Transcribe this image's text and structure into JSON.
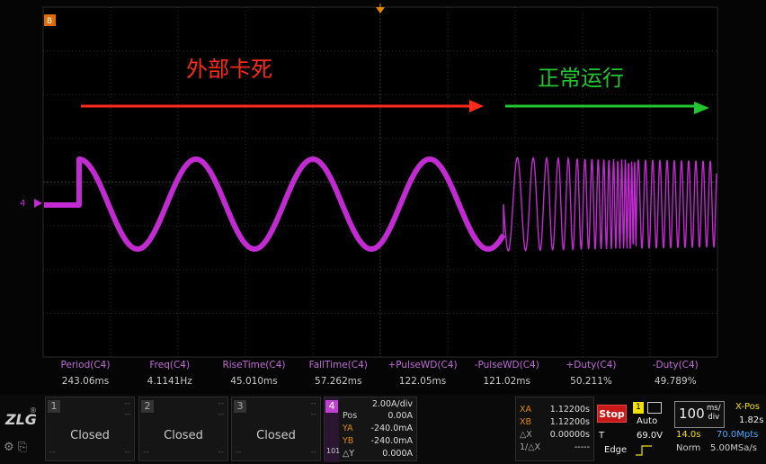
{
  "annotations": {
    "stuck_label": "外部卡死",
    "running_label": "正常运行",
    "stuck_color": "#ff2a1a",
    "running_color": "#22c532"
  },
  "channel_marker": {
    "label": "4",
    "color": "#c22bd1"
  },
  "top_badge": "B",
  "measurements": [
    {
      "name": "Period(C4)",
      "value": "243.06ms"
    },
    {
      "name": "Freq(C4)",
      "value": "4.1141Hz"
    },
    {
      "name": "RiseTime(C4)",
      "value": "45.010ms"
    },
    {
      "name": "FallTime(C4)",
      "value": "57.262ms"
    },
    {
      "name": "+PulseWD(C4)",
      "value": "122.05ms"
    },
    {
      "name": "-PulseWD(C4)",
      "value": "121.02ms"
    },
    {
      "name": "+Duty(C4)",
      "value": "50.211%"
    },
    {
      "name": "-Duty(C4)",
      "value": "49.789%"
    }
  ],
  "logo": {
    "text": "ZLG",
    "reg": "®"
  },
  "channels": [
    {
      "num": "1",
      "state": "Closed"
    },
    {
      "num": "2",
      "state": "Closed"
    },
    {
      "num": "3",
      "state": "Closed"
    }
  ],
  "channel4": {
    "num": "4",
    "scale": "2.00A/div",
    "pos_label": "Pos",
    "pos_value": "0.00A",
    "ya_label": "YA",
    "ya_value": "-240.0mA",
    "yb_label": "YB",
    "yb_value": "-240.0mA",
    "dy_label": "△Y",
    "dy_value": "0.000A",
    "bw_label": "101"
  },
  "cursors": {
    "xa_label": "XA",
    "xa_value": "1.12200s",
    "xb_label": "XB",
    "xb_value": "1.12200s",
    "dx_label": "△X",
    "dx_value": "0.00000s",
    "inv_label": "1/△X",
    "inv_value": "-----"
  },
  "run_state": "Stop",
  "trigger": {
    "source": "1",
    "mode": "Auto",
    "type_label": "T",
    "level": "69.0V",
    "edge_label": "Edge"
  },
  "timebase": {
    "value": "100",
    "unit_top": "ms/",
    "unit_bottom": "div",
    "xpos_label": "X-Pos",
    "xpos_value": "1.82s",
    "length": "14.0s",
    "points": "70.0Mpts",
    "mode": "Norm",
    "sample_rate": "5.00MSa/s"
  }
}
